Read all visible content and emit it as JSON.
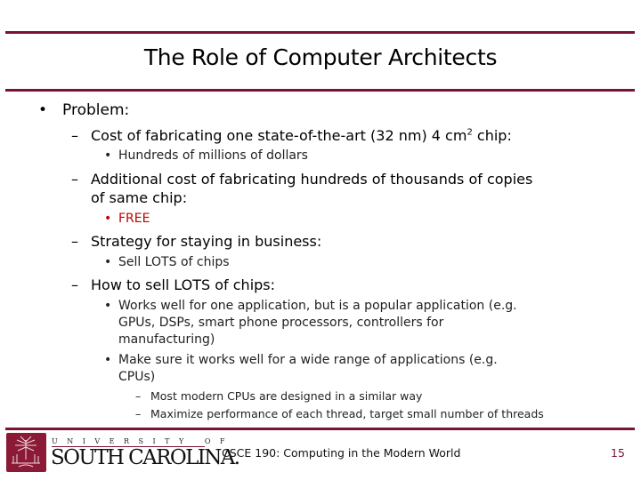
{
  "slide": {
    "title": "The Role of Computer Architects",
    "bullets": {
      "problem": "Problem:",
      "cost_one": "Cost of fabricating one state-of-the-art (32 nm) 4 cm",
      "cost_one_sup": "2",
      "cost_one_end": " chip:",
      "hundreds_millions": "Hundreds of millions of dollars",
      "additional_line1": "Additional cost of fabricating hundreds of thousands of copies",
      "additional_line2": "of same chip:",
      "free": "FREE",
      "strategy": "Strategy for staying in business:",
      "sell_lots": "Sell LOTS of chips",
      "how_to_sell": "How to sell LOTS of chips:",
      "works_well_line1": "Works well for one application, but is a popular application (e.g.",
      "works_well_line2": "GPUs, DSPs, smart phone processors, controllers for",
      "works_well_line3": "manufacturing)",
      "make_sure_line1": "Make sure it works well for a wide range of applications (e.g.",
      "make_sure_line2": "CPUs)",
      "most_modern": "Most modern CPUs are designed in a similar way",
      "maximize": "Maximize performance of each thread, target small number of threads"
    },
    "markers": {
      "bullet": "•",
      "dash": "–"
    }
  },
  "footer": {
    "logo_top": "UNIVERSITY OF",
    "logo_main": "SOUTH CAROLINA.",
    "course": "CSCE 190:  Computing in the Modern World",
    "page_number": "15"
  },
  "colors": {
    "accent": "#7a1331",
    "highlight": "#c00000"
  }
}
